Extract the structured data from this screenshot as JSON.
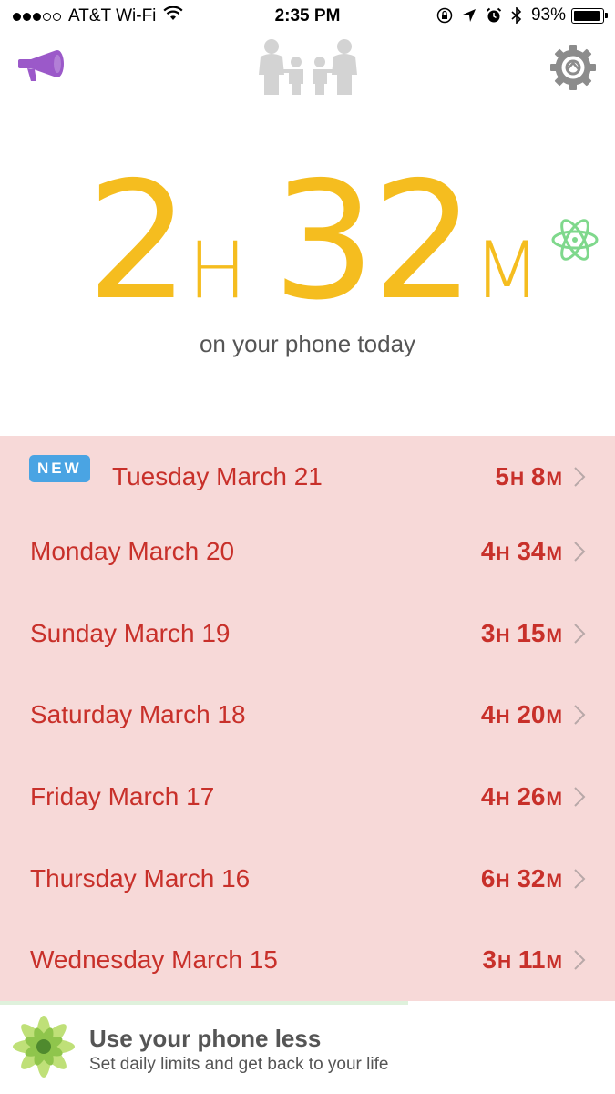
{
  "status_bar": {
    "carrier": "AT&T Wi-Fi",
    "time": "2:35 PM",
    "battery": "93%",
    "battery_level": 0.93,
    "signal_bars_filled": 3,
    "signal_bars_total": 5
  },
  "header": {
    "left_icon": "megaphone-icon",
    "center_icon": "family-icon",
    "right_icon": "gear-icon"
  },
  "today": {
    "hours": "2",
    "hours_unit": "H",
    "minutes": "32",
    "minutes_unit": "M",
    "label": "on your phone today",
    "badge_icon": "atom-icon"
  },
  "days": [
    {
      "name": "Tuesday March 21",
      "hours": "5",
      "minutes": "8",
      "badge": "NEW"
    },
    {
      "name": "Monday March 20",
      "hours": "4",
      "minutes": "34"
    },
    {
      "name": "Sunday March 19",
      "hours": "3",
      "minutes": "15"
    },
    {
      "name": "Saturday March 18",
      "hours": "4",
      "minutes": "20"
    },
    {
      "name": "Friday March 17",
      "hours": "4",
      "minutes": "26"
    },
    {
      "name": "Thursday March 16",
      "hours": "6",
      "minutes": "32"
    },
    {
      "name": "Wednesday March 15",
      "hours": "3",
      "minutes": "11"
    }
  ],
  "units": {
    "h": "H",
    "m": "M"
  },
  "banner": {
    "title": "Use your phone less",
    "subtitle": "Set daily limits and get back to your life",
    "icon": "lotus-icon"
  },
  "colors": {
    "accent_time": "#f5bd1f",
    "list_background": "#f7d9d8",
    "list_text": "#c8302a",
    "new_badge": "#4aa4e3",
    "megaphone": "#9b59c9"
  }
}
